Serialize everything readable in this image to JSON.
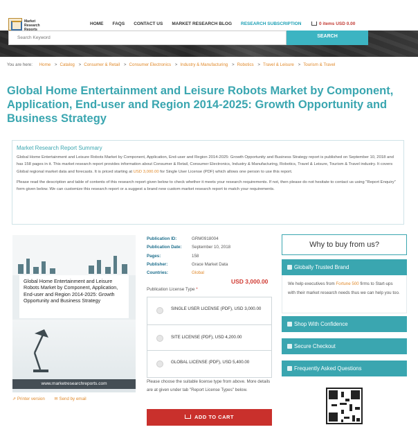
{
  "header": {
    "logo_text": "Market Research Reports",
    "nav": [
      "HOME",
      "FAQS",
      "CONTACT US",
      "MARKET RESEARCH BLOG",
      "RESEARCH SUBSCRIPTION"
    ],
    "cart": "0 items USD 0.00"
  },
  "search": {
    "placeholder": "Search Keyword",
    "button": "SEARCH"
  },
  "breadcrumb": {
    "prefix": "You are here:",
    "items": [
      "Home",
      "Catalog",
      "Consumer & Retail",
      "Consumer Electronics",
      "Industry & Manufacturing",
      "Robotics",
      "Travel & Leisure",
      "Tourism & Travel"
    ]
  },
  "title": "Global Home Entertainment and Leisure Robots Market by Component, Application, End-user and Region 2014-2025: Growth Opportunity and Business Strategy",
  "summary": {
    "heading": "Market Research Report Summary",
    "p1_a": "Global Home Entertainment and Leisure Robots Market by Component, Application, End-user and Region 2014-2025: Growth Opportunity and Business Strategy report is published on September 10, 2018 and has 158 pages in it. This market research report provides information about Consumer & Retail, Consumer Electronics, Industry & Manufacturing, Robotics, Travel & Leisure, Tourism & Travel industry. It covers Global regional market data and forecasts. It is priced starting at ",
    "p1_price": "USD 3,000.00",
    "p1_b": " for Single User License (PDF) which allows one person to use this report.",
    "p2": "Please read the description and table of contents of this research report given below to check whether it meets your research requirements. If not, then please do not hesitate to contact us using \"Report Enquiry\" form given below. We can customize this research report or a suggest a brand new custom market research report to match your requirements."
  },
  "product_image": {
    "caption": "Global Home Entertainment and Leisure Robots Market by Component, Application, End-user and Region 2014-2025: Growth Opportunity and Business Strategy",
    "url": "www.marketresearchreports.com"
  },
  "tools": {
    "print": "Printer version",
    "email": "Send by email"
  },
  "meta": {
    "publication_id_label": "Publication ID:",
    "publication_id": "GRM0918004",
    "publication_date_label": "Publication Date:",
    "publication_date": "September 10, 2018",
    "pages_label": "Pages:",
    "pages": "158",
    "publisher_label": "Publisher:",
    "publisher": "Grace Market Data",
    "countries_label": "Countries:",
    "countries": "Global"
  },
  "price": "USD 3,000.00",
  "license": {
    "label": "Publication License Type",
    "required_mark": "*",
    "options": [
      "SINGLE USER LICENSE (PDF), USD 3,000.00",
      "SITE LICENSE (PDF), USD 4,200.00",
      "GLOBAL LICENSE (PDF), USD 5,400.00"
    ],
    "note": "Please choose the suitable license type from above. More details are at given under tab \"Report License Types\" below."
  },
  "add_to_cart": "ADD TO CART",
  "why": {
    "heading": "Why to buy from us?",
    "globally_trusted": "Globally Trusted Brand",
    "gt_text_a": "We help executives from ",
    "gt_text_hl": "Fortune 500",
    "gt_text_b": " firms to Start-ups with their market research needs thus we can help you too.",
    "shop": "Shop With Confidence",
    "checkout": "Secure Checkout",
    "faq": "Frequently Asked Questions"
  },
  "colors": {
    "accent": "#3aa6b0",
    "link": "#e0892a",
    "cta": "#c9302c"
  }
}
